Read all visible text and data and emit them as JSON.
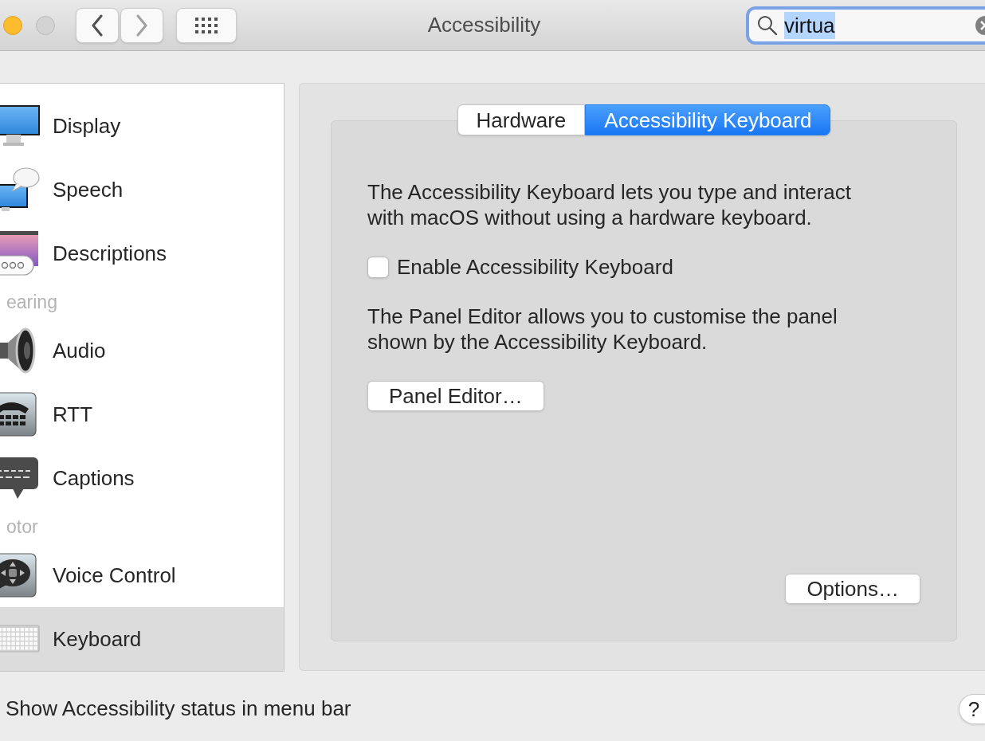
{
  "window": {
    "title": "Accessibility"
  },
  "toolbar": {
    "search": {
      "value": "virtua",
      "value_selected": true
    }
  },
  "sidebar": {
    "groups": [
      {
        "items": [
          {
            "label": "Display",
            "selected": false
          },
          {
            "label": "Speech",
            "selected": false
          },
          {
            "label": "Descriptions",
            "selected": false
          }
        ]
      },
      {
        "heading": "earing",
        "items": [
          {
            "label": "Audio",
            "selected": false
          },
          {
            "label": "RTT",
            "selected": false
          },
          {
            "label": "Captions",
            "selected": false
          }
        ]
      },
      {
        "heading": "otor",
        "items": [
          {
            "label": "Voice Control",
            "selected": false
          },
          {
            "label": "Keyboard",
            "selected": true
          }
        ]
      }
    ]
  },
  "tabs": [
    {
      "label": "Hardware",
      "selected": false
    },
    {
      "label": "Accessibility Keyboard",
      "selected": true
    }
  ],
  "panel": {
    "description": "The Accessibility Keyboard lets you type and interact with macOS without using a hardware keyboard.",
    "enable_checkbox": {
      "label": "Enable Accessibility Keyboard",
      "checked": false
    },
    "editor_note": "The Panel Editor allows you to customise the panel shown by the Accessibility Keyboard.",
    "panel_editor_button": "Panel Editor…",
    "options_button": "Options…"
  },
  "footer": {
    "status_label": "Show Accessibility status in menu bar",
    "help_button": "?"
  }
}
